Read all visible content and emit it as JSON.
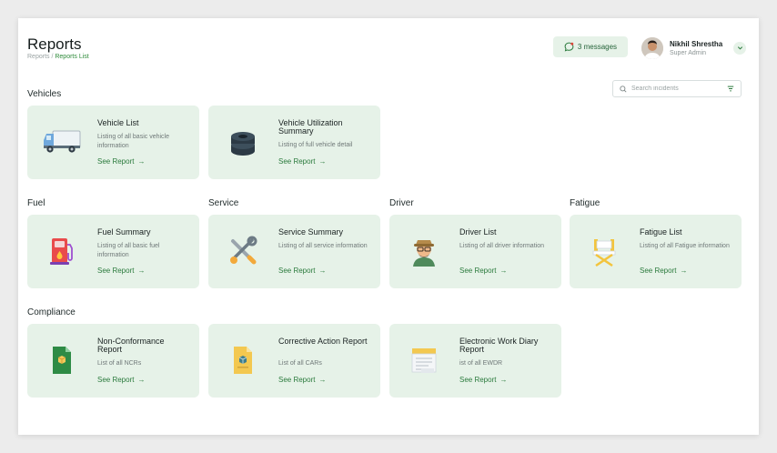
{
  "header": {
    "title": "Reports",
    "breadcrumb": {
      "root": "Reports",
      "separator": " / ",
      "current": "Reports List"
    },
    "messages_label": "3 messages",
    "user": {
      "name": "Nikhil Shrestha",
      "role": "Super Admin"
    }
  },
  "search": {
    "placeholder": "Search incidents",
    "value": ""
  },
  "sections": {
    "vehicles": "Vehicles",
    "fuel": "Fuel",
    "service": "Service",
    "driver": "Driver",
    "fatigue": "Fatigue",
    "compliance": "Compliance"
  },
  "cards": {
    "vehicle_list": {
      "title": "Vehicle List",
      "desc": "Listing of all basic vehicle information",
      "link": "See Report",
      "icon": "truck-icon"
    },
    "vehicle_utilization": {
      "title": "Vehicle Utilization Summary",
      "desc": "Listing of full vehicle detail",
      "link": "See Report",
      "icon": "tires-icon"
    },
    "fuel_summary": {
      "title": "Fuel Summary",
      "desc": "Listing of all basic fuel information",
      "link": "See Report",
      "icon": "fuel-pump-icon"
    },
    "service_summary": {
      "title": "Service Summary",
      "desc": "Listing of all service information",
      "link": "See Report",
      "icon": "tools-icon"
    },
    "driver_list": {
      "title": "Driver List",
      "desc": "Listing of all driver information",
      "link": "See Report",
      "icon": "driver-icon"
    },
    "fatigue_list": {
      "title": "Fatigue List",
      "desc": "Listing of all Fatigue information",
      "link": "See Report",
      "icon": "director-chair-icon"
    },
    "ncr": {
      "title": "Non-Conformance Report",
      "desc": "List of all NCRs",
      "link": "See Report",
      "icon": "spreadsheet-document-icon"
    },
    "car": {
      "title": "Corrective Action Report",
      "desc": "List of all CARs",
      "link": "See Report",
      "icon": "document-box-icon"
    },
    "ewdr": {
      "title": "Electronic Work Diary Report",
      "desc": "ist of all EWDR",
      "link": "See Report",
      "icon": "notepad-icon"
    }
  },
  "colors": {
    "accent": "#2a7a3c",
    "card_bg": "#e6f2e8",
    "page_bg": "#ffffff"
  }
}
